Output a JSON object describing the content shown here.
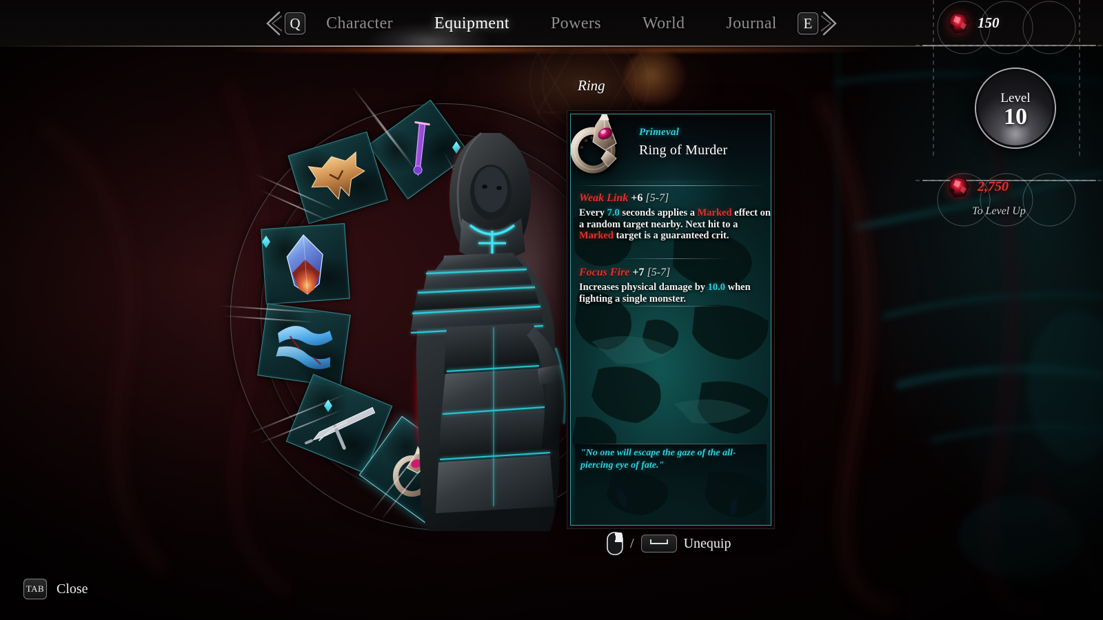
{
  "nav": {
    "prev_key": "Q",
    "next_key": "E",
    "prev_icon": "chevron-left-icon",
    "next_icon": "chevron-right-icon",
    "tabs": [
      {
        "label": "Character",
        "active": false
      },
      {
        "label": "Equipment",
        "active": true
      },
      {
        "label": "Powers",
        "active": false
      },
      {
        "label": "World",
        "active": false
      },
      {
        "label": "Journal",
        "active": false
      }
    ]
  },
  "slot_label": "Ring",
  "item": {
    "rarity": "Primeval",
    "name": "Ring of Murder",
    "icon": "ring-icon",
    "affixes": [
      {
        "name": "Weak Link",
        "value": "+6",
        "range": "[5-7]",
        "description_parts": [
          {
            "text": "Every ",
            "style": "plain"
          },
          {
            "text": "7.0",
            "style": "num"
          },
          {
            "text": " seconds applies a ",
            "style": "plain"
          },
          {
            "text": "Marked",
            "style": "red"
          },
          {
            "text": " effect on a random target nearby. Next hit to a ",
            "style": "plain"
          },
          {
            "text": "Marked",
            "style": "red"
          },
          {
            "text": " target is a guaranteed crit.",
            "style": "plain"
          }
        ]
      },
      {
        "name": "Focus Fire",
        "value": "+7",
        "range": "[5-7]",
        "description_parts": [
          {
            "text": "Increases physical damage by ",
            "style": "plain"
          },
          {
            "text": "10.0",
            "style": "num"
          },
          {
            "text": " when fighting a single monster.",
            "style": "plain"
          }
        ]
      }
    ],
    "flavor": "\"No one will escape the gaze of the all-piercing eye of fate.\""
  },
  "action_prompt": {
    "mouse_icon": "mouse-right-click-icon",
    "separator": "/",
    "key_icon": "spacebar-key-icon",
    "label": "Unequip"
  },
  "close_prompt": {
    "key": "TAB",
    "label": "Close"
  },
  "hud": {
    "currency_top": {
      "icon": "red-ore-icon",
      "value": "150"
    },
    "level": {
      "word": "Level",
      "value": "10"
    },
    "currency_bottom": {
      "icon": "red-ore-icon",
      "value": "2,750"
    },
    "to_level_up": "To Level Up"
  },
  "equipment_slots": [
    {
      "name": "wand-slot",
      "icon": "purple-wand-icon",
      "equipped": true,
      "marked": true
    },
    {
      "name": "helmet-slot",
      "icon": "bronze-helm-icon",
      "equipped": true,
      "marked": false
    },
    {
      "name": "amulet-slot",
      "icon": "fire-crystal-icon",
      "equipped": true,
      "marked": true
    },
    {
      "name": "offhand-slot",
      "icon": "blue-claw-icon",
      "equipped": true,
      "marked": false
    },
    {
      "name": "sword-slot",
      "icon": "silver-sword-icon",
      "equipped": true,
      "marked": true
    },
    {
      "name": "ring-slot",
      "icon": "ring-icon",
      "equipped": true,
      "marked": false,
      "selected": true
    }
  ],
  "colors": {
    "accent_teal": "#2fd0dd",
    "accent_red": "#e0322e",
    "panel_border": "#50d7e1",
    "text_primary": "#ffffff",
    "text_dim": "#8d8d92"
  }
}
